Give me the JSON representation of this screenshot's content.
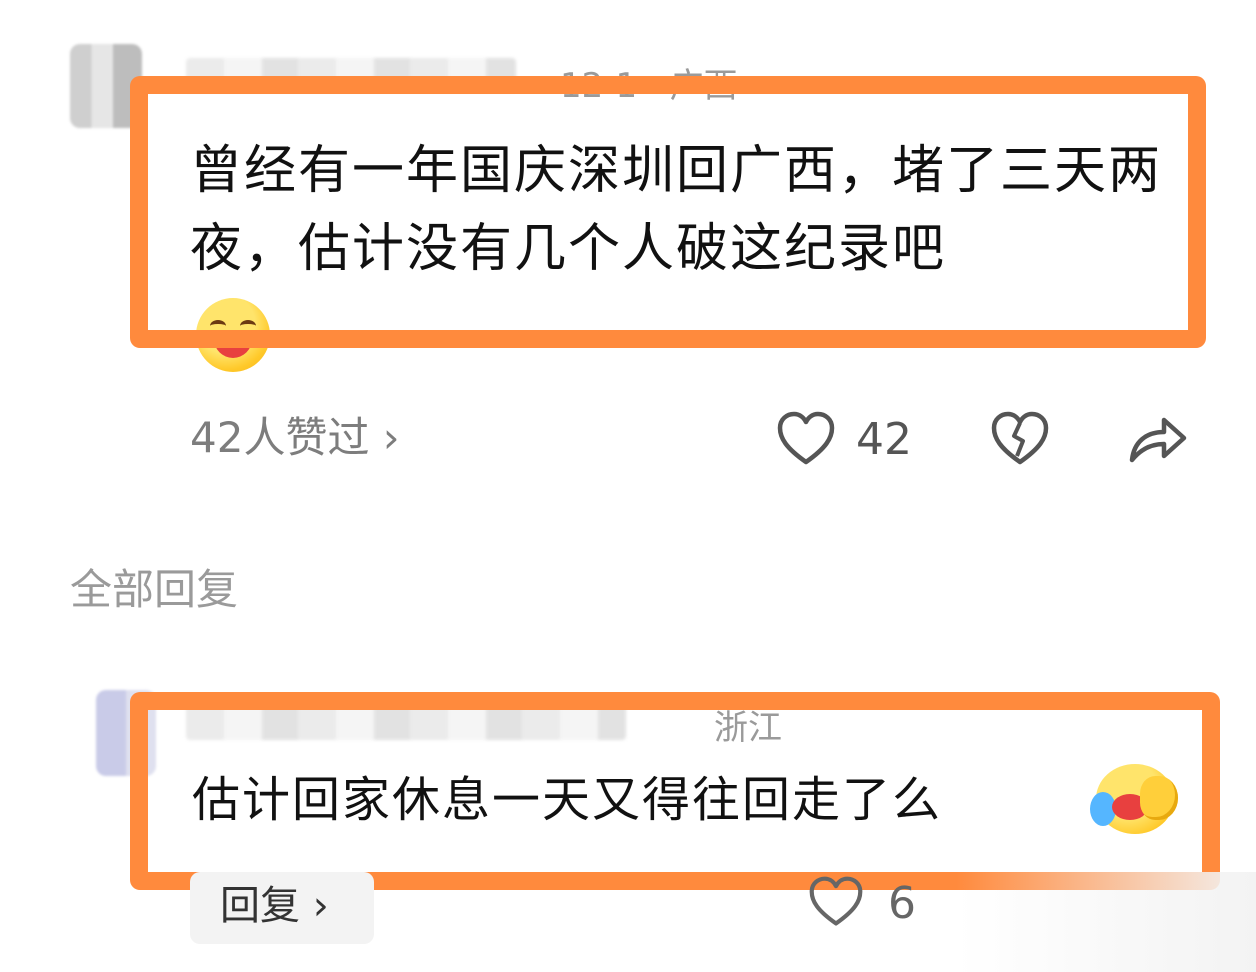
{
  "comment": {
    "meta_partial": "12-1 · 广西",
    "text": "曾经有一年国庆深圳回广西，堵了三天两夜，估计没有几个人破这纪录吧",
    "emoji": "grinning-squinting-face-with-tears",
    "likers_link": "42人赞过 ›",
    "like_count": "42",
    "icons": [
      "heart-icon",
      "broken-heart-icon",
      "share-arrow-icon"
    ]
  },
  "replies_section": {
    "title": "全部回复"
  },
  "reply": {
    "meta_partial": "浙江",
    "text": "估计回家休息一天又得往回走了么",
    "emoji": "rolling-on-floor-laughing-face",
    "reply_button": "回复 ›",
    "like_count": "6"
  },
  "colors": {
    "highlight": "#ff8a3d",
    "meta_gray": "#9a9a9a",
    "secondary_gray": "#7d7d7d"
  }
}
